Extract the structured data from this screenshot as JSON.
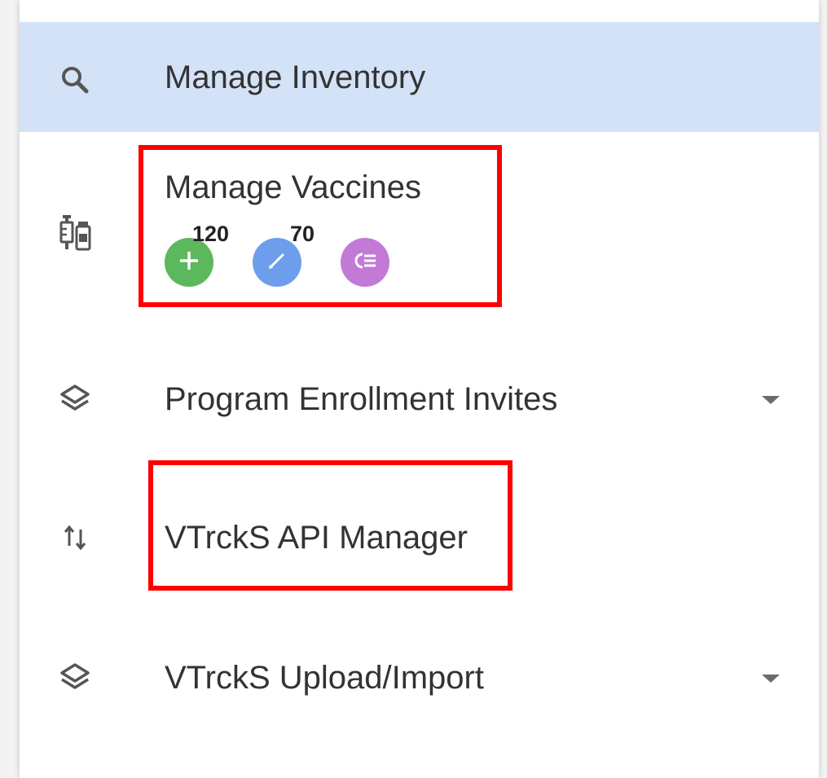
{
  "nav": {
    "items": [
      {
        "label": "Manage Inventory",
        "icon": "search-icon",
        "selected": true
      },
      {
        "label": "Manage Vaccines",
        "icon": "vaccine-syringe-vial-icon",
        "actions": [
          {
            "icon": "plus-icon",
            "count": "120",
            "color": "#5cb85c"
          },
          {
            "icon": "pencil-icon",
            "count": "70",
            "color": "#6d9eeb"
          },
          {
            "icon": "list-icon",
            "count": "",
            "color": "#c27ad6"
          }
        ]
      },
      {
        "label": "Program Enrollment Invites",
        "icon": "layers-icon",
        "expandable": true
      },
      {
        "label": "VTrckS API Manager",
        "icon": "sort-arrows-icon"
      },
      {
        "label": "VTrckS Upload/Import",
        "icon": "layers-icon",
        "expandable": true
      }
    ]
  },
  "colors": {
    "selected_background": "#d3e2f7",
    "highlight": "#ff0000",
    "text": "#333333"
  }
}
